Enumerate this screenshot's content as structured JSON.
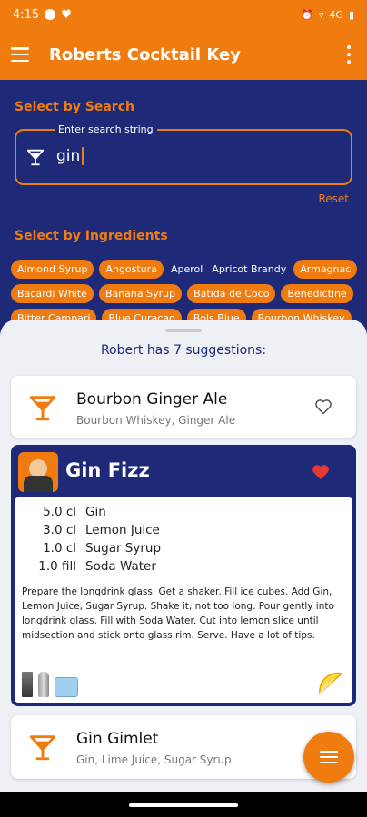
{
  "status": {
    "time": "4:15",
    "network": "4G"
  },
  "appbar": {
    "title": "Roberts Cocktail Key"
  },
  "search": {
    "section_label": "Select by Search",
    "field_label": "Enter search string",
    "value": "gin",
    "reset_label": "Reset"
  },
  "ingredients": {
    "section_label": "Select by Ingredients",
    "chips": [
      "Almond Syrup",
      "Angostura",
      "Aperol",
      "Apricot Brandy",
      "Armagnac",
      "Bacardi White",
      "Banana Syrup",
      "Batida de Coco",
      "Benedictine",
      "Bitter Campari",
      "Blue Curacao",
      "Bols Blue",
      "Bourbon Whiskey"
    ]
  },
  "suggestions": {
    "header": "Robert has 7 suggestions:",
    "items": [
      {
        "name": "Bourbon Ginger Ale",
        "ingredients": "Bourbon Whiskey, Ginger Ale",
        "favorite": false
      },
      {
        "name": "Gin Fizz",
        "favorite": true,
        "recipe": [
          {
            "amount": "5.0 cl",
            "ingredient": "Gin"
          },
          {
            "amount": "3.0 cl",
            "ingredient": "Lemon Juice"
          },
          {
            "amount": "1.0 cl",
            "ingredient": "Sugar Syrup"
          },
          {
            "amount": "1.0 fill",
            "ingredient": "Soda Water"
          }
        ],
        "instructions": "Prepare the longdrink glass. Get a shaker. Fill ice cubes. Add Gin, Lemon Juice, Sugar Syrup. Shake it, not too long. Pour gently into longdrink glass. Fill with Soda Water. Cut into lemon slice until midsection and stick onto glass rim. Serve. Have a lot of tips."
      },
      {
        "name": "Gin Gimlet",
        "ingredients": "Gin, Lime Juice, Sugar Syrup",
        "favorite": false
      }
    ]
  },
  "colors": {
    "accent": "#f07c10",
    "navy": "#1e2a78",
    "heart": "#e53935"
  }
}
